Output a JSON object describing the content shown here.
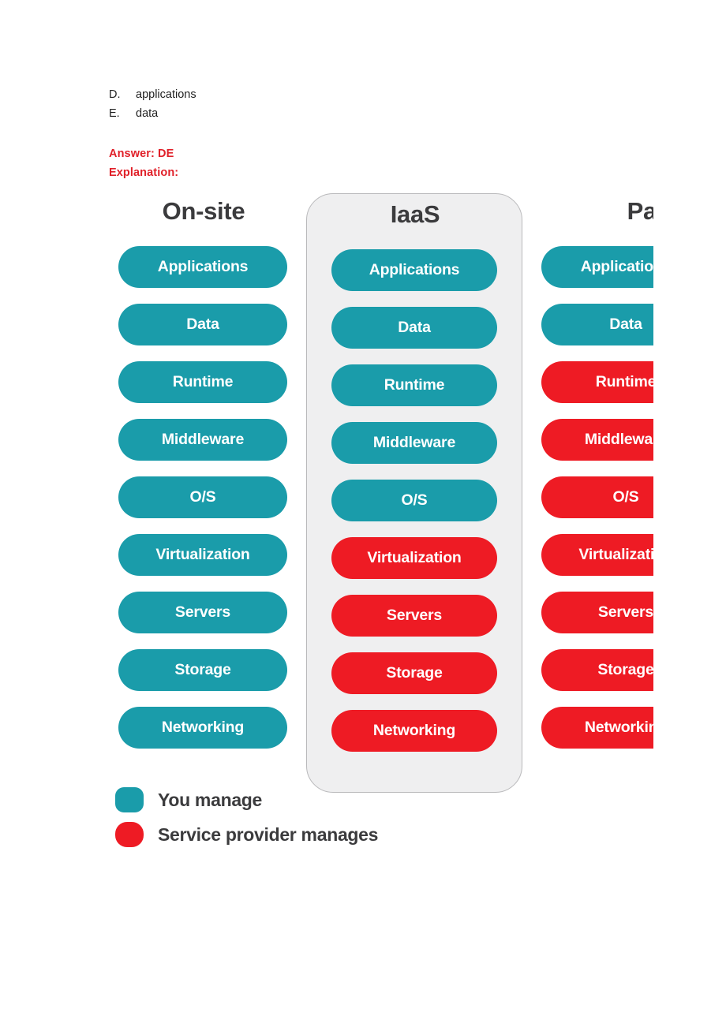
{
  "question": {
    "options": [
      {
        "letter": "D.",
        "label": "applications"
      },
      {
        "letter": "E.",
        "label": "data"
      }
    ],
    "answer_line": "Answer: DE",
    "explanation_line": "Explanation:",
    "answer_color": "#e02029"
  },
  "diagram": {
    "colors": {
      "you_manage": "#1a9caa",
      "provider_manages": "#ee1b24",
      "highlight_frame_bg": "#efeff0",
      "highlight_frame_border": "#b9b9bb",
      "title_text": "#3b3b3d"
    },
    "columns": [
      {
        "title": "On-site",
        "highlighted": false,
        "layers": [
          {
            "label": "Applications",
            "owner": "teal"
          },
          {
            "label": "Data",
            "owner": "teal"
          },
          {
            "label": "Runtime",
            "owner": "teal"
          },
          {
            "label": "Middleware",
            "owner": "teal"
          },
          {
            "label": "O/S",
            "owner": "teal"
          },
          {
            "label": "Virtualization",
            "owner": "teal"
          },
          {
            "label": "Servers",
            "owner": "teal"
          },
          {
            "label": "Storage",
            "owner": "teal"
          },
          {
            "label": "Networking",
            "owner": "teal"
          }
        ]
      },
      {
        "title": "IaaS",
        "highlighted": true,
        "layers": [
          {
            "label": "Applications",
            "owner": "teal"
          },
          {
            "label": "Data",
            "owner": "teal"
          },
          {
            "label": "Runtime",
            "owner": "teal"
          },
          {
            "label": "Middleware",
            "owner": "teal"
          },
          {
            "label": "O/S",
            "owner": "teal"
          },
          {
            "label": "Virtualization",
            "owner": "red"
          },
          {
            "label": "Servers",
            "owner": "red"
          },
          {
            "label": "Storage",
            "owner": "red"
          },
          {
            "label": "Networking",
            "owner": "red"
          }
        ]
      },
      {
        "title": "PaaS",
        "highlighted": false,
        "clipped_at_page_edge": true,
        "layers": [
          {
            "label": "Applications",
            "owner": "teal"
          },
          {
            "label": "Data",
            "owner": "teal"
          },
          {
            "label": "Runtime",
            "owner": "red"
          },
          {
            "label": "Middleware",
            "owner": "red"
          },
          {
            "label": "O/S",
            "owner": "red"
          },
          {
            "label": "Virtualization",
            "owner": "red"
          },
          {
            "label": "Servers",
            "owner": "red"
          },
          {
            "label": "Storage",
            "owner": "red"
          },
          {
            "label": "Networking",
            "owner": "red"
          }
        ]
      }
    ],
    "legend": [
      {
        "swatch": "teal",
        "label": "You manage"
      },
      {
        "swatch": "red",
        "label": "Service provider manages"
      }
    ]
  }
}
